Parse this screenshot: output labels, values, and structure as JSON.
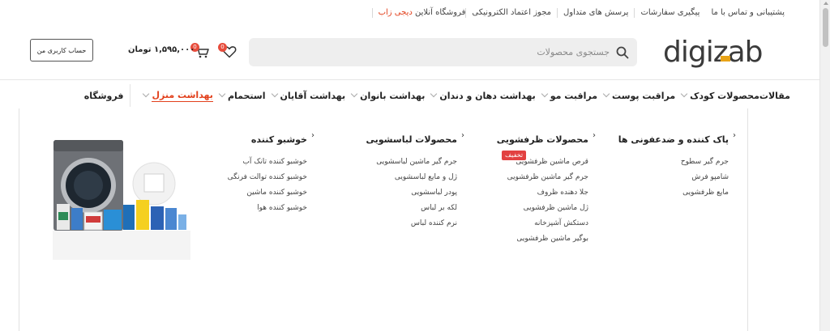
{
  "topbar": {
    "items": [
      {
        "label": "فروشگاه آنلاین",
        "brand": "دیجی زاب"
      },
      {
        "label": "مجوز اعتماد الکترونیکی"
      },
      {
        "label": "پرسش های متداول"
      },
      {
        "label": "پیگیری سفارشات"
      },
      {
        "label": "پشتیبانی و تماس با ما"
      }
    ]
  },
  "header": {
    "logo_text": "digizab",
    "search_placeholder": "جستجوی محصولات",
    "wishlist_count": "0",
    "cart_count": "0",
    "cart_total": "۱,۵۹۵,۰۰۰ تومان",
    "account_label": "حساب کاربری من"
  },
  "nav": {
    "items": [
      {
        "label": "فروشگاه",
        "has_dropdown": false
      },
      {
        "label": "بهداشت منزل",
        "has_dropdown": true,
        "active": true
      },
      {
        "label": "استحمام",
        "has_dropdown": true
      },
      {
        "label": "بهداشت آقایان",
        "has_dropdown": true
      },
      {
        "label": "بهداشت بانوان",
        "has_dropdown": true
      },
      {
        "label": "بهداشت دهان و دندان",
        "has_dropdown": true
      },
      {
        "label": "مراقبت مو",
        "has_dropdown": true
      },
      {
        "label": "مراقبت پوست",
        "has_dropdown": true
      },
      {
        "label": "محصولات کودک",
        "has_dropdown": true
      },
      {
        "label": "مقالات",
        "has_dropdown": false
      }
    ]
  },
  "mega_menu": {
    "columns": [
      {
        "title": "پاک کننده و ضدعفونی ها",
        "items": [
          "جرم گیر سطوح",
          "شامپو فرش",
          "مایع ظرفشویی"
        ]
      },
      {
        "title": "محصولات ظرفشویی",
        "sale_label": "تخفیف",
        "items": [
          "قرص ماشین ظرفشویی",
          "جرم گیر ماشین ظرفشویی",
          "جلا دهنده ظروف",
          "ژل ماشین ظرفشویی",
          "دستکش آشپزخانه",
          "بوگیر ماشین ظرفشویی"
        ]
      },
      {
        "title": "محصولات لباسشویی",
        "items": [
          "جرم گیر ماشین لباسشویی",
          "ژل و مایع لباسشویی",
          "پودر لباسشویی",
          "لکه بر لباس",
          "نرم کننده لباس"
        ]
      },
      {
        "title": "خوشبو کننده",
        "items": [
          "خوشبو کننده تانک آب",
          "خوشبو کننده توالت فرنگی",
          "خوشبو کننده ماشین",
          "خوشبو کننده هوا"
        ]
      }
    ]
  },
  "colors": {
    "accent": "#e2401c",
    "badge": "#e74c3c",
    "search_bg": "#eeeeee",
    "logo_gold": "#e8a317"
  }
}
